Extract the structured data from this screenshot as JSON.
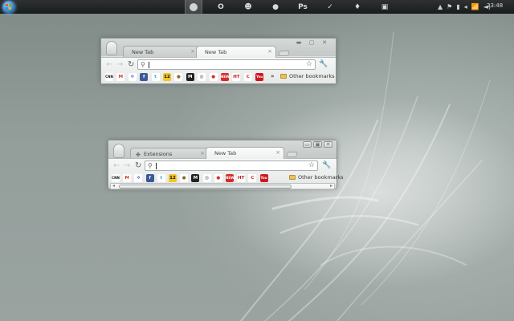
{
  "taskbar": {
    "clock": "23:48",
    "apps": [
      {
        "name": "chrome-app",
        "glyph": "",
        "active": true
      },
      {
        "name": "opera-app",
        "glyph": "O"
      },
      {
        "name": "messenger-app",
        "glyph": "☻"
      },
      {
        "name": "media-app",
        "glyph": "●"
      },
      {
        "name": "photoshop-app",
        "glyph": "Ps"
      },
      {
        "name": "brush-app",
        "glyph": "✓"
      },
      {
        "name": "lamp-app",
        "glyph": "♦"
      },
      {
        "name": "notes-app",
        "glyph": "▣"
      }
    ],
    "tray": [
      "▲",
      "⚑",
      "▮",
      "◂",
      "📶",
      "◄)"
    ]
  },
  "window1": {
    "tabs": [
      {
        "label": "New Tab",
        "active": false
      },
      {
        "label": "New Tab",
        "active": true
      }
    ],
    "omnibox": {
      "value": "",
      "placeholder": ""
    },
    "other_bookmarks": "Other bookmarks",
    "overflow": "»"
  },
  "window2": {
    "tabs": [
      {
        "label": "Extensions",
        "active": false,
        "icon": "puzzle-icon"
      },
      {
        "label": "New Tab",
        "active": true
      }
    ],
    "omnibox": {
      "value": "",
      "placeholder": ""
    },
    "other_bookmarks": "Other bookmarks"
  },
  "bookmarks": [
    {
      "name": "cnn",
      "text": "CNN",
      "color": "#ffffff",
      "fg": "#111111"
    },
    {
      "name": "gmail",
      "text": "M",
      "color": "#ffffff",
      "fg": "#d23b2c"
    },
    {
      "name": "gear-site",
      "text": "✲",
      "color": "#ffffff",
      "fg": "#3a58c7"
    },
    {
      "name": "facebook",
      "text": "f",
      "color": "#3b5998",
      "fg": "#ffffff"
    },
    {
      "name": "twitter",
      "text": "t",
      "color": "#ffffff",
      "fg": "#29a8e0"
    },
    {
      "name": "imdb-12",
      "text": "12",
      "color": "#f3c623",
      "fg": "#111111"
    },
    {
      "name": "ball-site",
      "text": "●",
      "color": "#ffffff",
      "fg": "#8c6a2a"
    },
    {
      "name": "m-site",
      "text": "M",
      "color": "#222222",
      "fg": "#ffffff"
    },
    {
      "name": "camera-site",
      "text": "◎",
      "color": "#ffffff",
      "fg": "#333333"
    },
    {
      "name": "reddit-like",
      "text": "●",
      "color": "#ffffff",
      "fg": "#d8322b"
    },
    {
      "name": "news-site",
      "text": "NEWS",
      "color": "#d42b2b",
      "fg": "#ffffff"
    },
    {
      "name": "ht-site",
      "text": "HT",
      "color": "#ffffff",
      "fg": "#c4161c"
    },
    {
      "name": "c-site",
      "text": "C",
      "color": "#ffffff",
      "fg": "#d42b2b"
    },
    {
      "name": "youtube",
      "text": "You",
      "color": "#cc181e",
      "fg": "#ffffff"
    }
  ]
}
